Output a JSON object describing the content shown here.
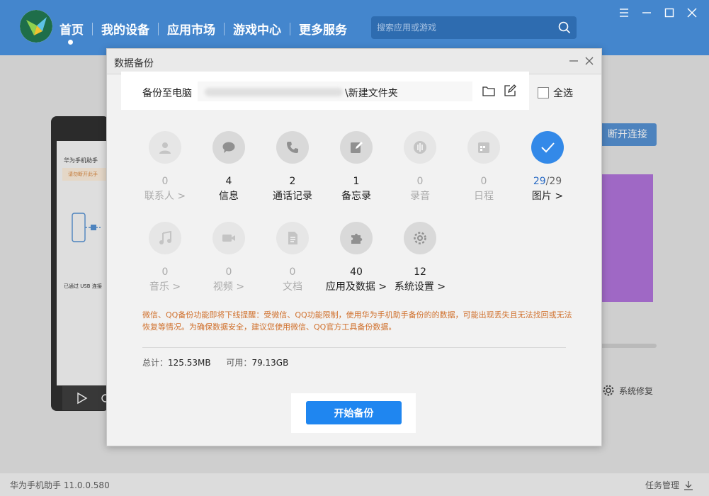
{
  "app": {
    "nav": [
      "首页",
      "我的设备",
      "应用市场",
      "游戏中心",
      "更多服务"
    ],
    "search_placeholder": "搜索应用或游戏",
    "version": "华为手机助手 11.0.0.580",
    "task_manager": "任务管理"
  },
  "background": {
    "disconnect": "断开连接",
    "system_repair": "系统修复",
    "phone_title": "华为手机助手",
    "phone_warning": "请勿断开此手",
    "phone_usb": "已通过 USB 连接"
  },
  "modal": {
    "title": "数据备份",
    "backup_to_label": "备份至电脑",
    "path_visible": "\\新建文件夹",
    "select_all": "全选",
    "items": [
      {
        "count": "0",
        "label": "联系人 >",
        "icon": "contacts-icon"
      },
      {
        "count": "4",
        "label": "信息",
        "icon": "message-icon"
      },
      {
        "count": "2",
        "label": "通话记录",
        "icon": "phone-icon"
      },
      {
        "count": "1",
        "label": "备忘录",
        "icon": "memo-icon"
      },
      {
        "count": "0",
        "label": "录音",
        "icon": "recording-icon"
      },
      {
        "count": "0",
        "label": "日程",
        "icon": "calendar-icon"
      },
      {
        "count_a": "29",
        "count_b": "/29",
        "label": "图片 >",
        "icon": "check-icon"
      },
      {
        "count": "0",
        "label": "音乐 >",
        "icon": "music-icon"
      },
      {
        "count": "0",
        "label": "视频 >",
        "icon": "video-icon"
      },
      {
        "count": "0",
        "label": "文档",
        "icon": "document-icon"
      },
      {
        "count": "40",
        "label": "应用及数据 >",
        "icon": "puzzle-icon"
      },
      {
        "count": "12",
        "label": "系统设置 >",
        "icon": "settings-icon"
      }
    ],
    "notice": "微信、QQ备份功能即将下线提醒：受微信、QQ功能限制，使用华为手机助手备份的的数据，可能出现丢失且无法找回或无法恢复等情况。为确保数据安全，建议您使用微信、QQ官方工具备份数据。",
    "total_label": "总计：",
    "total_value": "125.53MB",
    "available_label": "可用：",
    "available_value": "79.13GB",
    "start_button": "开始备份"
  },
  "colors": {
    "header": "#4486cd",
    "primary_button": "#1f86f0",
    "checked": "#3389e8",
    "notice": "#d0702c"
  }
}
